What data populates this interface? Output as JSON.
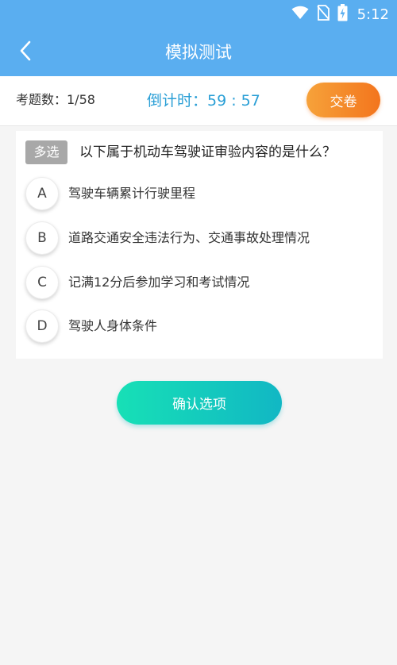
{
  "status_bar": {
    "time": "5:12",
    "icons": [
      "wifi-icon",
      "no-sim-icon",
      "battery-charging-icon"
    ]
  },
  "header": {
    "title": "模拟测试",
    "back_icon": "chevron-left-icon"
  },
  "info_bar": {
    "question_count": "考题数：1/58",
    "countdown": "倒计时：59 : 57",
    "submit_label": "交卷"
  },
  "question": {
    "type_tag": "多选",
    "text": "以下属于机动车驾驶证审验内容的是什么？",
    "options": [
      {
        "letter": "A",
        "text": "驾驶车辆累计行驶里程"
      },
      {
        "letter": "B",
        "text": "道路交通安全违法行为、交通事故处理情况"
      },
      {
        "letter": "C",
        "text": "记满12分后参加学习和考试情况"
      },
      {
        "letter": "D",
        "text": "驾驶人身体条件"
      }
    ]
  },
  "confirm_label": "确认选项",
  "colors": {
    "header": "#5aaef0",
    "countdown": "#2a9fd6",
    "submit_gradient": [
      "#f6a23a",
      "#f3751d"
    ],
    "confirm_gradient": [
      "#17e0b6",
      "#11b7c4"
    ]
  }
}
